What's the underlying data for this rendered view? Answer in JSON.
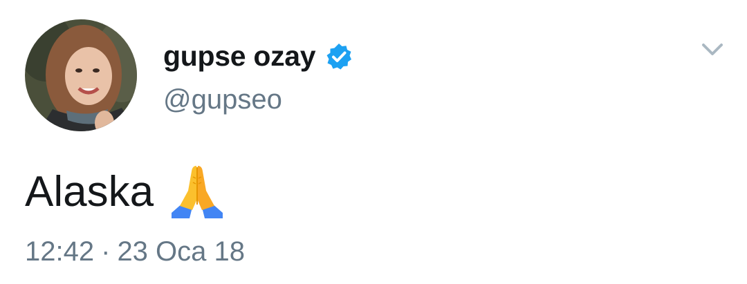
{
  "tweet": {
    "author": {
      "display_name": "gupse ozay",
      "handle": "@gupseo",
      "verified": true,
      "avatar": "profile-photo"
    },
    "text": "Alaska",
    "emoji": "folded-hands",
    "time": "12:42",
    "separator": "·",
    "date": "23 Oca 18",
    "menu_icon": "chevron-down-icon"
  },
  "colors": {
    "primary_text": "#14171a",
    "secondary_text": "#657786",
    "verified_badge": "#1da1f2",
    "caret": "#aab8c2"
  }
}
